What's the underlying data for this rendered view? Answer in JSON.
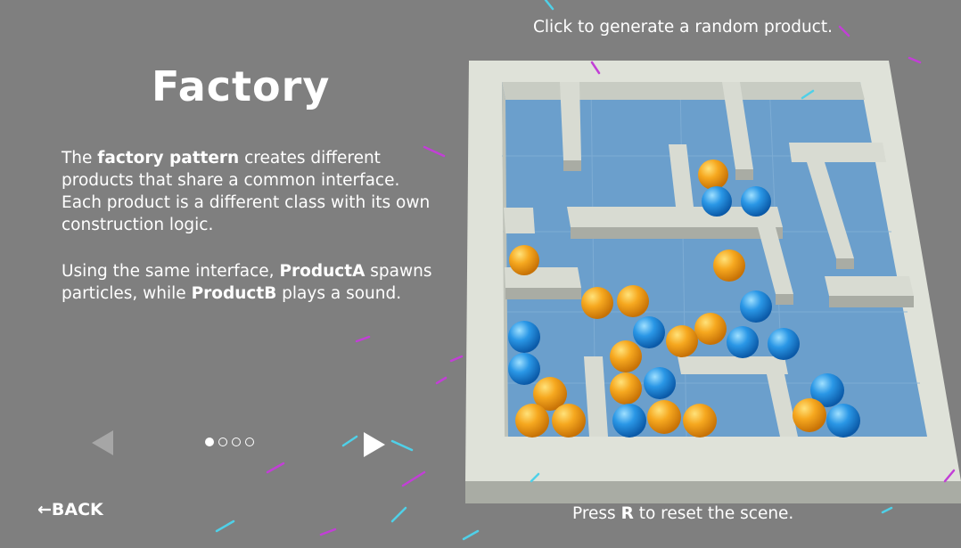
{
  "panel": {
    "title": "Factory",
    "para1": {
      "t1": "The ",
      "b1": "factory pattern",
      "t2": " creates different products that share a common interface. Each product is a different class with its own construction logic."
    },
    "para2": {
      "t1": "Using the same interface, ",
      "b1": "ProductA",
      "t2": " spawns particles, while ",
      "b2": "ProductB",
      "t3": " plays a sound."
    },
    "pagination": {
      "total": 4,
      "current": 1
    },
    "back_label": "←BACK"
  },
  "scene": {
    "top_hint": "Click to generate a random product.",
    "bottom_hint": {
      "t1": "Press ",
      "key": "R",
      "t2": " to reset the scene."
    },
    "colors": {
      "orange_ball": "#f5a623",
      "blue_ball": "#1e90e0",
      "floor": "#6a9cc9",
      "wall": "#dcdfd6"
    }
  }
}
